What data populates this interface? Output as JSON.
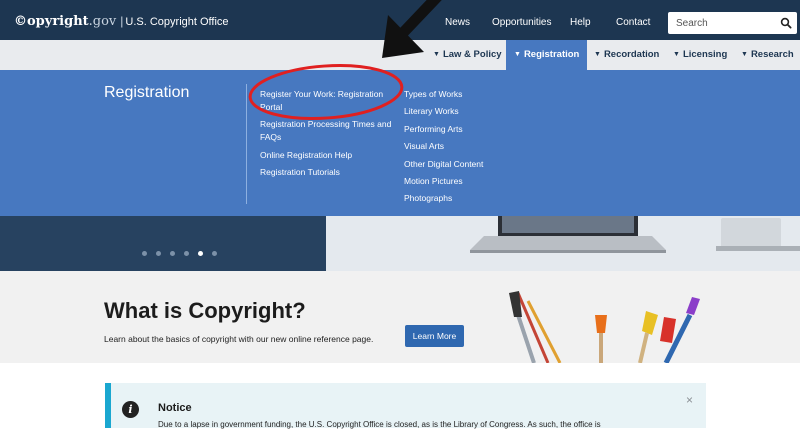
{
  "header": {
    "logo_main": "©opyright",
    "logo_domain": ".gov",
    "logo_separator": "|",
    "office_name": "U.S. Copyright Office",
    "links": [
      "News",
      "Opportunities",
      "Help",
      "Contact"
    ],
    "search_placeholder": "Search"
  },
  "subnav": {
    "items": [
      "Law & Policy",
      "Registration",
      "Recordation",
      "Licensing",
      "Research"
    ],
    "active": "Registration"
  },
  "dropdown": {
    "title": "Registration",
    "col1": [
      "Register Your Work: Registration Portal",
      "Registration Processing Times and FAQs",
      "Online Registration Help",
      "Registration Tutorials"
    ],
    "col2": [
      "Types of Works",
      "Literary Works",
      "Performing Arts",
      "Visual Arts",
      "Other Digital Content",
      "Motion Pictures",
      "Photographs"
    ]
  },
  "carousel": {
    "slide_count": 6,
    "active_index": 4
  },
  "what_is_copyright": {
    "title": "What is Copyright?",
    "description": "Learn about the basics of copyright with our new online reference page.",
    "button": "Learn More"
  },
  "notice": {
    "title": "Notice",
    "close": "×",
    "icon": "i",
    "text": "Due to a lapse in government funding, the U.S. Copyright Office is closed, as is the Library of Congress. As such, the office is"
  },
  "annotations": {
    "arrow_color": "#111111",
    "circle_color": "#e02020"
  }
}
